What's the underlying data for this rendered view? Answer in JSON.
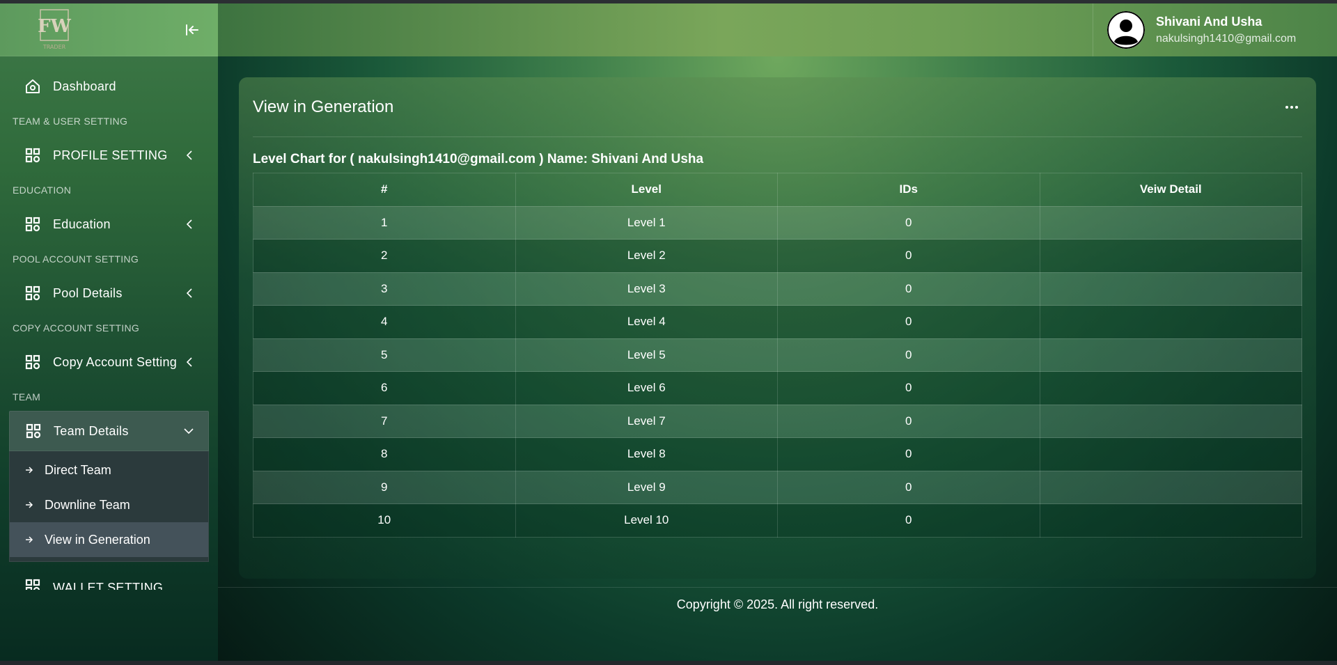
{
  "sidebar": {
    "logo_text": "FW",
    "logo_subtext": "TRADER",
    "items": [
      {
        "label": "Dashboard"
      },
      {
        "section": "TEAM & USER SETTING"
      },
      {
        "label": "PROFILE SETTING"
      },
      {
        "section": "EDUCATION"
      },
      {
        "label": "Education"
      },
      {
        "section": "POOL ACCOUNT SETTING"
      },
      {
        "label": "Pool Details"
      },
      {
        "section": "COPY ACCOUNT SETTING"
      },
      {
        "label": "Copy Account Setting"
      },
      {
        "section": "TEAM"
      },
      {
        "label": "Team Details"
      },
      {
        "label": "WALLET SETTING"
      }
    ],
    "team_submenu": [
      {
        "label": "Direct Team"
      },
      {
        "label": "Downline Team"
      },
      {
        "label": "View in Generation"
      }
    ]
  },
  "header": {
    "user_name": "Shivani And Usha",
    "user_email": "nakulsingh1410@gmail.com"
  },
  "main": {
    "card_title": "View in Generation",
    "caption": "Level Chart for ( nakulsingh1410@gmail.com ) Name: Shivani And Usha",
    "columns": [
      "#",
      "Level",
      "IDs",
      "Veiw Detail"
    ],
    "rows": [
      [
        "1",
        "Level 1",
        "0",
        ""
      ],
      [
        "2",
        "Level 2",
        "0",
        ""
      ],
      [
        "3",
        "Level 3",
        "0",
        ""
      ],
      [
        "4",
        "Level 4",
        "0",
        ""
      ],
      [
        "5",
        "Level 5",
        "0",
        ""
      ],
      [
        "6",
        "Level 6",
        "0",
        ""
      ],
      [
        "7",
        "Level 7",
        "0",
        ""
      ],
      [
        "8",
        "Level 8",
        "0",
        ""
      ],
      [
        "9",
        "Level 9",
        "0",
        ""
      ],
      [
        "10",
        "Level 10",
        "0",
        ""
      ]
    ]
  },
  "footer": {
    "text": "Copyright © 2025. All right reserved."
  }
}
